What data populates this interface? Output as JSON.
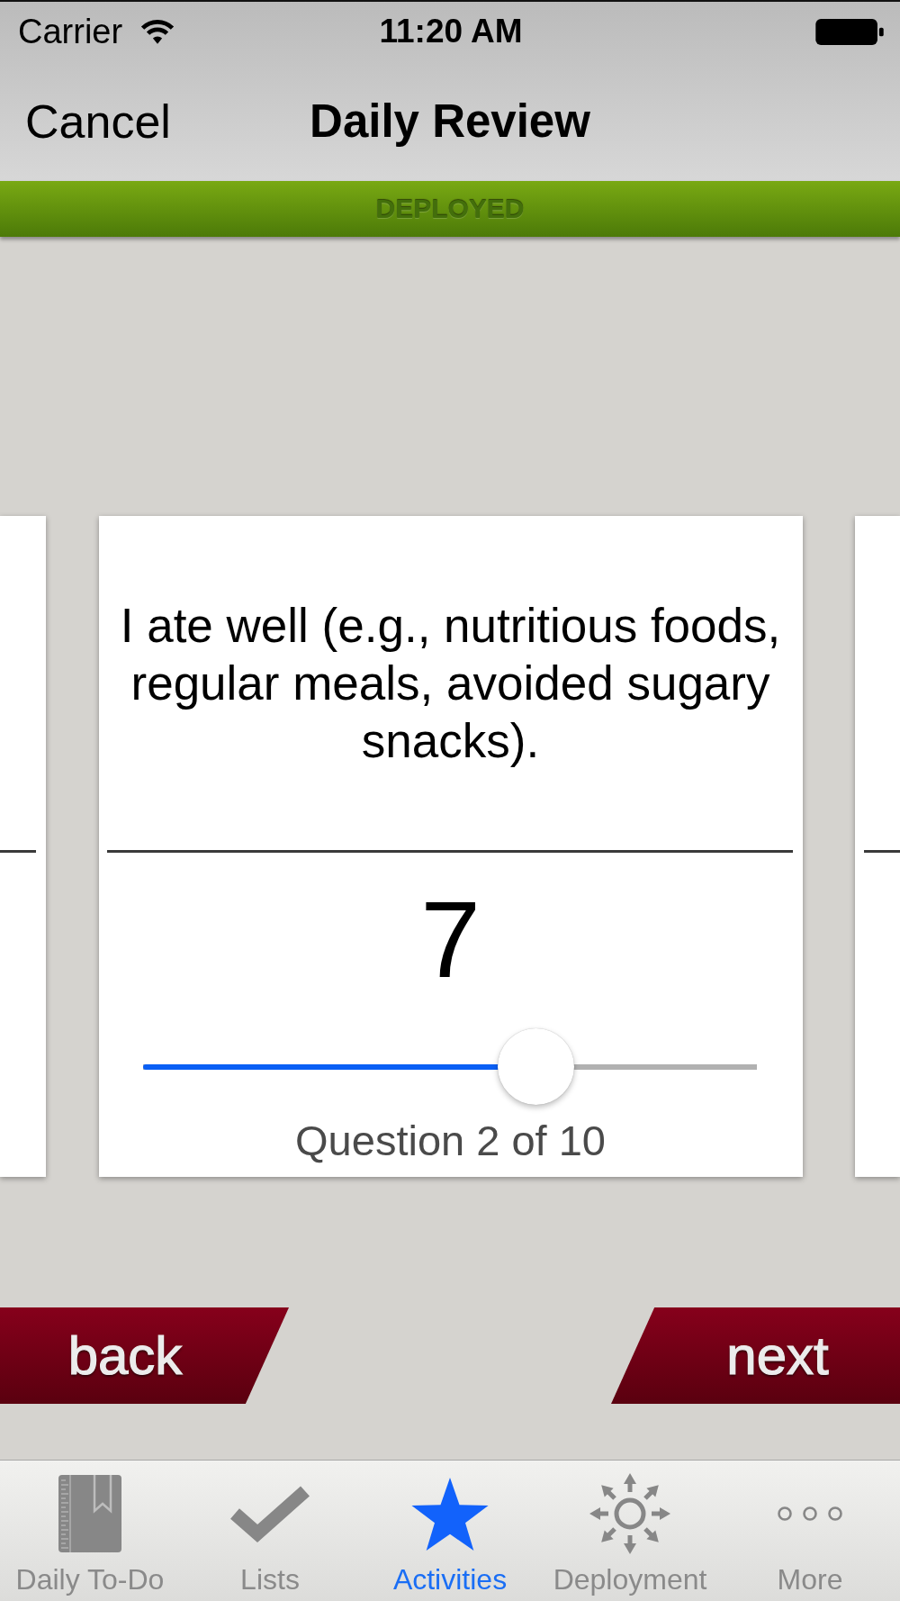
{
  "status_bar": {
    "carrier": "Carrier",
    "time": "11:20 AM"
  },
  "nav_bar": {
    "cancel": "Cancel",
    "title": "Daily Review"
  },
  "banner": {
    "label": "DEPLOYED"
  },
  "card": {
    "question": "I ate well (e.g., nutritious foods, regular meals, avoided sugary snacks).",
    "value": "7",
    "slider": {
      "level": 0.66
    },
    "progress": "Question 2 of 10"
  },
  "buttons": [
    {
      "kind": "back",
      "label": "back"
    },
    {
      "kind": "next",
      "label": "next"
    }
  ],
  "tab_bar": {
    "items": [
      {
        "label": "Daily To-Do",
        "selected": false
      },
      {
        "label": "Lists",
        "selected": false
      },
      {
        "label": "Activities",
        "selected": true
      },
      {
        "label": "Deployment",
        "selected": false
      },
      {
        "label": "More",
        "selected": false
      }
    ]
  }
}
